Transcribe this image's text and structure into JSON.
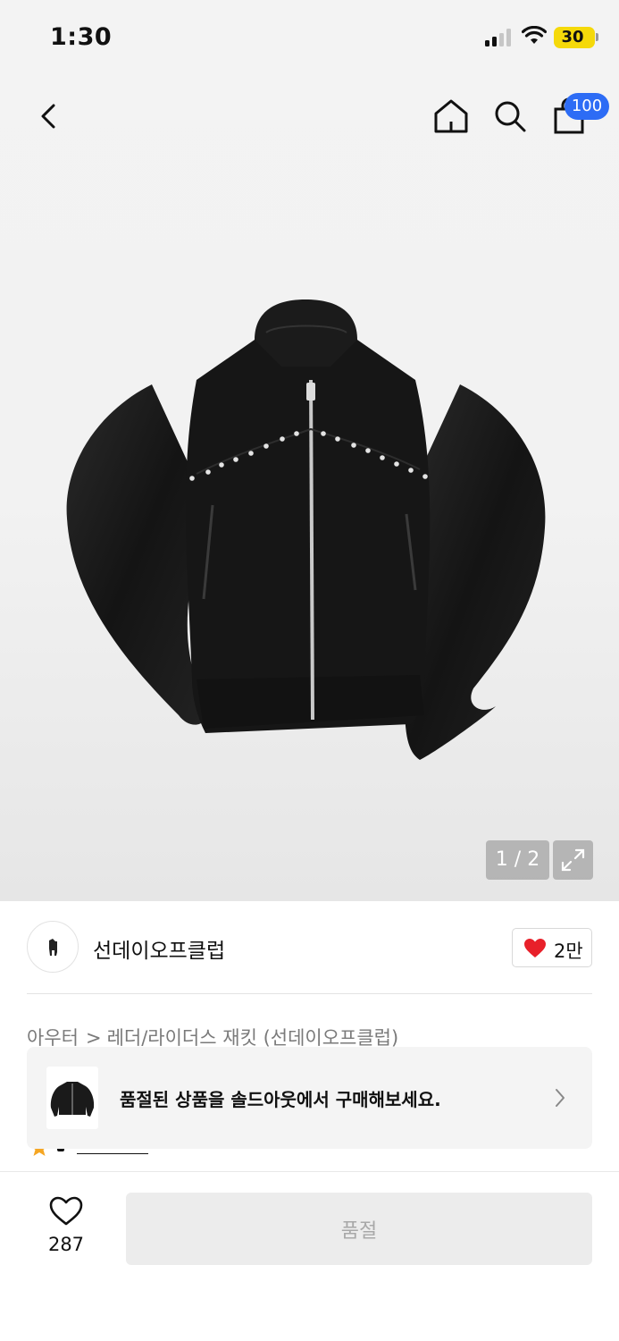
{
  "status_bar": {
    "time": "1:30",
    "battery": "30"
  },
  "nav": {
    "cart_count": "100",
    "icons": [
      "back-icon",
      "home-icon",
      "search-icon",
      "shopping-bag-icon"
    ]
  },
  "gallery": {
    "pager": "1 / 2"
  },
  "brand": {
    "name": "선데이오프클럽",
    "likes": "2만"
  },
  "breadcrumb": {
    "category": "아우터",
    "separator": ">",
    "subcategory": "레더/라이더스 재킷 (선데이오프클럽)"
  },
  "soldout_banner": {
    "message": "품절된 상품을 솔드아웃에서 구매해보세요."
  },
  "bottom_bar": {
    "wish_count": "287",
    "buy_label": "품절"
  },
  "colors": {
    "accent_blue": "#2d6cf5",
    "heart_red": "#e8202a",
    "battery_yellow": "#f5d90a"
  }
}
